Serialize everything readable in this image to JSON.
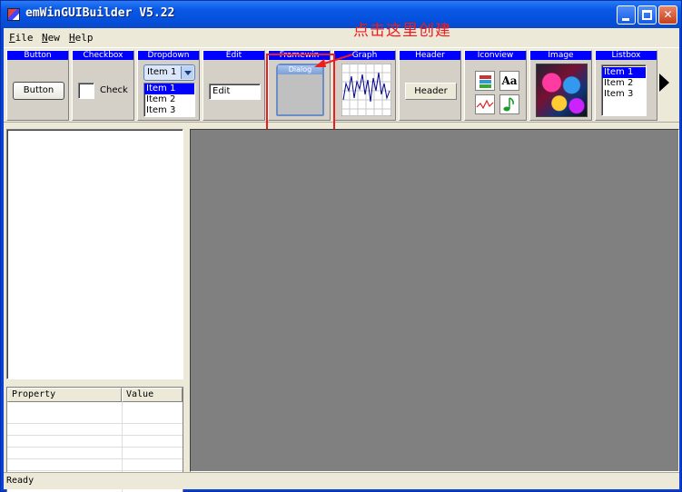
{
  "window": {
    "title": "emWinGUIBuilder V5.22"
  },
  "menu": [
    {
      "label_underline": "F",
      "label_rest": "ile"
    },
    {
      "label_underline": "N",
      "label_rest": "ew"
    },
    {
      "label_underline": "H",
      "label_rest": "elp"
    }
  ],
  "toolbar": {
    "widgets": [
      {
        "name": "Button",
        "sample": "Button"
      },
      {
        "name": "Checkbox",
        "sample": "Check"
      },
      {
        "name": "Dropdown",
        "sample": "Item 1",
        "items": [
          "Item 1",
          "Item 2",
          "Item 3"
        ]
      },
      {
        "name": "Edit",
        "sample": "Edit"
      },
      {
        "name": "Framewin",
        "sample": "Dialog"
      },
      {
        "name": "Graph"
      },
      {
        "name": "Header",
        "sample": "Header"
      },
      {
        "name": "Iconview",
        "sample": "Aa"
      },
      {
        "name": "Image"
      },
      {
        "name": "Listbox",
        "items": [
          "Item 1",
          "Item 2",
          "Item 3"
        ]
      }
    ]
  },
  "annotation": {
    "text": "点击这里创建",
    "color": "#ee1c1c"
  },
  "properties": {
    "col_property": "Property",
    "col_value": "Value"
  },
  "status": {
    "text": "Ready"
  },
  "colors": {
    "title_blue": "#0a5ae8",
    "widget_header": "#0000ff",
    "canvas": "#808080",
    "chrome": "#ece9d8"
  }
}
